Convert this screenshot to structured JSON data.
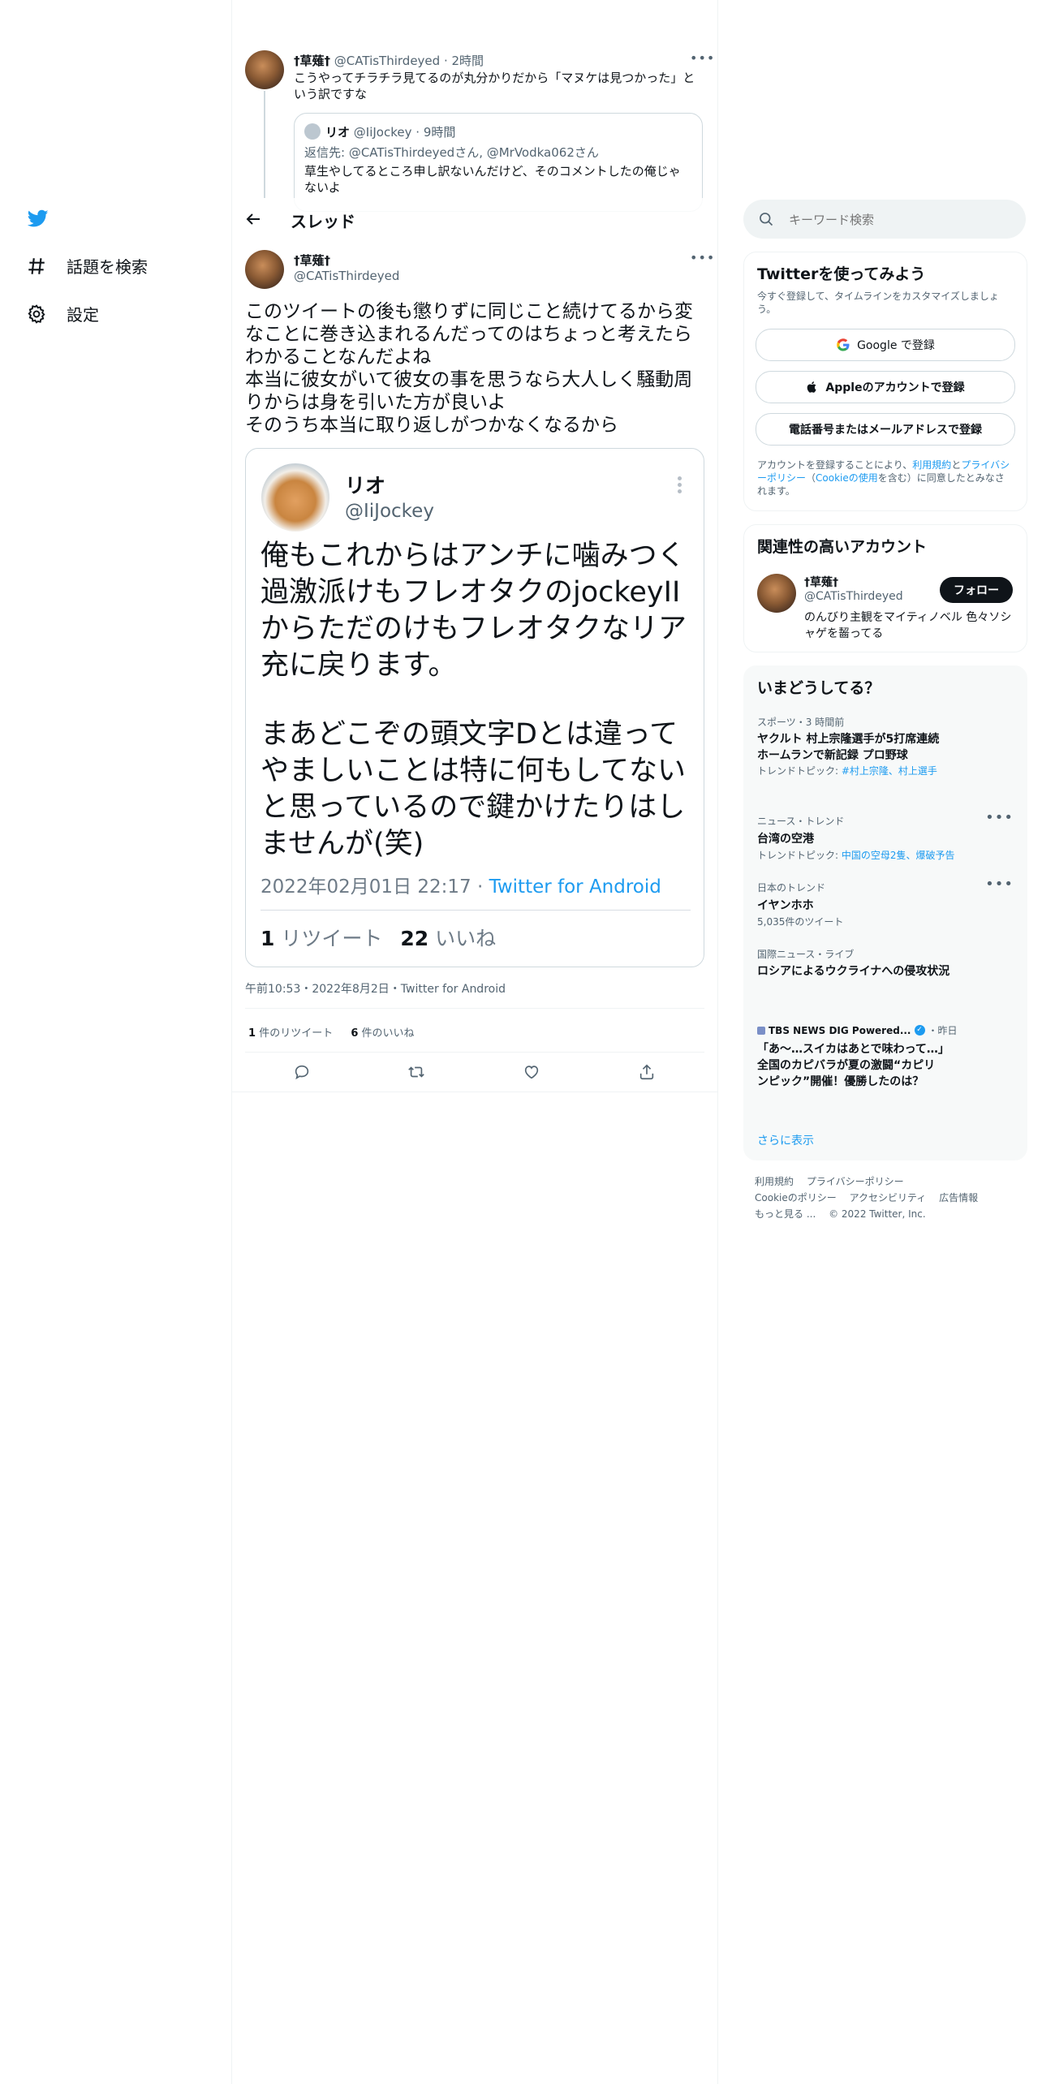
{
  "nav": {
    "explore_label": "話題を検索",
    "settings_label": "設定"
  },
  "header": {
    "back_icon": "arrow-left-icon",
    "title": "スレッド"
  },
  "parent_tweet": {
    "display_name": "†草薙†",
    "handle": "@CATisThirdeyed",
    "time": "2時間",
    "text": "こうやってチラチラ見てるのが丸分かりだから「マヌケは見つかった」という訳ですな",
    "quote": {
      "display_name": "リオ",
      "handle": "@IiJockey",
      "time": "9時間",
      "reply_to": "返信先: @CATisThirdeyedさん, @MrVodka062さん",
      "text": "草生やしてるところ申し訳ないんだけど、そのコメントしたの俺じゃないよ"
    }
  },
  "main_tweet": {
    "display_name": "†草薙†",
    "handle": "@CATisThirdeyed",
    "text": "このツイートの後も懲りずに同じこと続けてるから変なことに巻き込まれるんだってのはちょっと考えたらわかることなんだよね\n本当に彼女がいて彼女の事を思うなら大人しく騒動周りからは身を引いた方が良いよ\nそのうち本当に取り返しがつかなくなるから",
    "image": {
      "name": "リオ",
      "handle": "@IiJockey",
      "text_1": "俺もこれからはアンチに噛みつく過激派けもフレオタクのjockeyIIからただのけもフレオタクなリア充に戻ります。",
      "text_2": "まあどこぞの頭文字Dとは違ってやましいことは特に何もしてないと思っているので鍵かけたりはしませんが(笑)",
      "date": "2022年02月01日 22:17",
      "separator": " · ",
      "client": "Twitter for Android",
      "retweet_count": "1",
      "retweet_label": "リツイート",
      "like_count": "22",
      "like_label": "いいね"
    },
    "meta": "午前10:53・2022年8月2日・Twitter for Android",
    "retweets_count": "1",
    "retweets_label": "件のリツイート",
    "likes_count": "6",
    "likes_label": "件のいいね"
  },
  "search": {
    "placeholder": "キーワード検索"
  },
  "signup": {
    "title": "Twitterを使ってみよう",
    "subtitle": "今すぐ登録して、タイムラインをカスタマイズしましょう。",
    "google_label": "Google で登録",
    "apple_label": "Appleのアカウントで登録",
    "phone_label": "電話番号またはメールアドレスで登録",
    "legal_prefix": "アカウントを登録することにより、",
    "legal_terms": "利用規約",
    "legal_and": "と",
    "legal_privacy": "プライバシーポリシー",
    "legal_open": "（",
    "legal_cookie": "Cookieの使用",
    "legal_suffix": "を含む）に同意したとみなされます。"
  },
  "related": {
    "title": "関連性の高いアカウント",
    "display_name": "†草薙†",
    "handle": "@CATisThirdeyed",
    "bio": "のんびり主観をマイティノベル 色々ソシャゲを齧ってる",
    "follow_label": "フォロー"
  },
  "trends": {
    "title": "いまどうしてる？",
    "items": [
      {
        "context": "スポーツ・3 時間前",
        "title": "ヤクルト 村上宗隆選手が5打席連続ホームランで新記録 プロ野球",
        "topic_prefix": "トレンドトピック: ",
        "topic": "#村上宗隆、村上選手"
      },
      {
        "context": "ニュース・トレンド",
        "title": "台湾の空港",
        "topic_prefix": "トレンドトピック: ",
        "topic": "中国の空母2隻、爆破予告"
      },
      {
        "context": "日本のトレンド",
        "title": "イヤンホホ",
        "count": "5,035件のツイート"
      },
      {
        "context": "国際ニュース・ライブ",
        "title": "ロシアによるウクライナへの侵攻状況"
      }
    ],
    "news": {
      "source": "TBS NEWS DIG Powered...",
      "time": "・昨日",
      "title": "「あ～…スイカはあとで味わって…」全国のカピバラが夏の激闘“カピリンピック”開催！優勝したのは？"
    },
    "show_more": "さらに表示"
  },
  "footer": {
    "terms": "利用規約",
    "privacy": "プライバシーポリシー",
    "cookie": "Cookieのポリシー",
    "accessibility": "アクセシビリティ",
    "ads": "広告情報",
    "more": "もっと見る ...",
    "copyright": "© 2022 Twitter, Inc."
  },
  "colors": {
    "accent": "#1d9bf0",
    "text": "#0f1419",
    "secondary": "#536471",
    "border": "#eff3f4"
  }
}
